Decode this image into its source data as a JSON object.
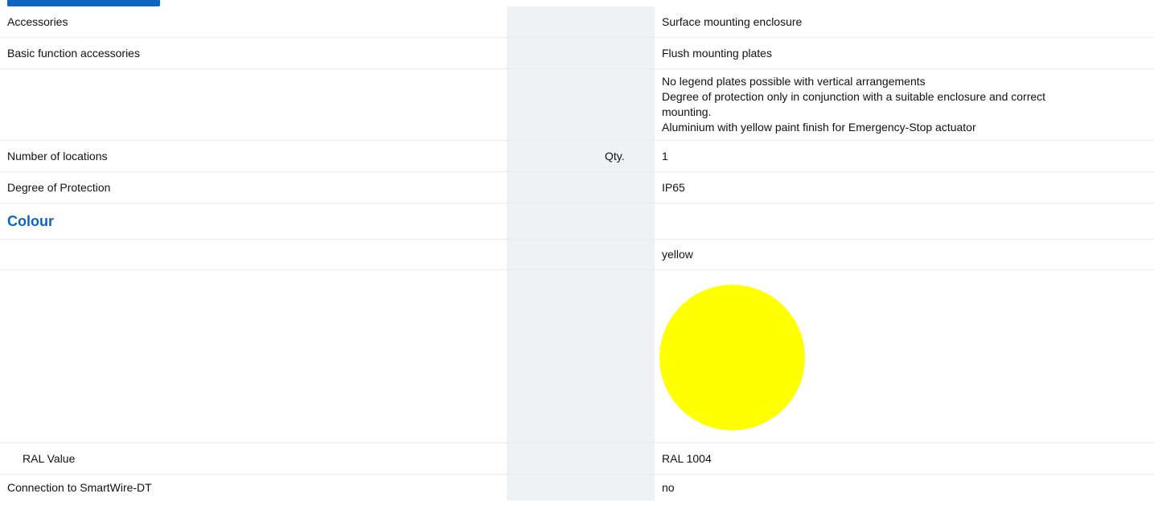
{
  "rows": {
    "accessories": {
      "label": "Accessories",
      "value": "Surface mounting enclosure"
    },
    "basic_function": {
      "label": "Basic function accessories",
      "value": "Flush mounting plates"
    },
    "notes": {
      "lines": [
        "No legend plates possible with vertical arrangements",
        "Degree of protection only in conjunction with a suitable enclosure and correct",
        "mounting.",
        "Aluminium with yellow paint finish for Emergency-Stop actuator"
      ]
    },
    "locations": {
      "label": "Number of locations",
      "unit": "Qty.",
      "value": "1"
    },
    "protection": {
      "label": "Degree of Protection",
      "value": "IP65"
    },
    "colour_section": {
      "title": "Colour"
    },
    "colour_name": {
      "value": "yellow"
    },
    "colour_swatch": {
      "color": "#ffff00"
    },
    "ral": {
      "label": "RAL Value",
      "value": "RAL 1004"
    },
    "smartwire": {
      "label": "Connection to SmartWire-DT",
      "value": "no"
    }
  },
  "colors": {
    "accent": "#0a66c2",
    "shade": "#f0f1f5",
    "divider": "#e9ebef"
  }
}
